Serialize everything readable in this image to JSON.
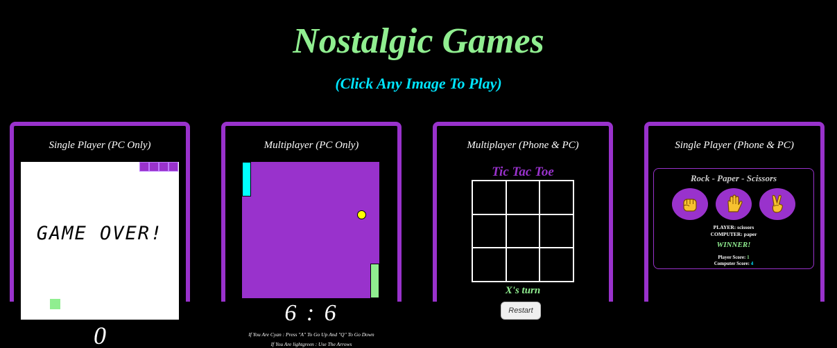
{
  "page": {
    "title": "Nostalgic Games",
    "subtitle": "(Click Any Image To Play)"
  },
  "colors": {
    "background": "#000000",
    "accent_purple": "#9932cc",
    "title_green": "#90ee90",
    "subtitle_cyan": "#00e5ff",
    "ball_yellow": "#ffff00"
  },
  "cards": {
    "snake": {
      "label": "Single Player (PC Only)",
      "game_over": "GAME OVER!",
      "score": "0"
    },
    "pong": {
      "label": "Multiplayer (PC Only)",
      "score": "6 : 6",
      "help_cyan": "If You Are Cyan : Press \"A\" To Go Up And \"Q\" To Go Down",
      "help_green": "If You Are lightgreen : Use The Arrows"
    },
    "tictactoe": {
      "label": "Multiplayer (Phone & PC)",
      "title": "Tic Tac Toe",
      "status": "X's turn",
      "restart_label": "Restart",
      "cells": [
        "",
        "",
        "",
        "",
        "",
        "",
        "",
        "",
        ""
      ]
    },
    "rps": {
      "label": "Single Player (Phone & PC)",
      "title": "Rock - Paper - Scissors",
      "buttons": [
        "rock-icon",
        "paper-icon",
        "scissors-icon"
      ],
      "player_choice": "PLAYER: scissors",
      "computer_choice": "COMPUTER: paper",
      "result": "WINNER!",
      "player_score_label": "Player Score: ",
      "player_score": "1",
      "computer_score_label": "Computer Score: ",
      "computer_score": "4"
    }
  }
}
